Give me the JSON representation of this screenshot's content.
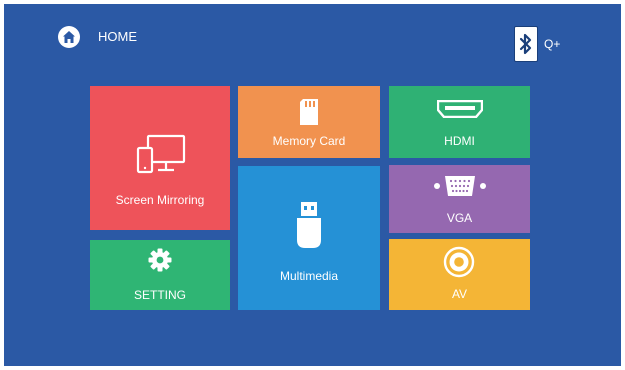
{
  "header": {
    "home_label": "HOME",
    "home_icon": "home-icon",
    "bluetooth_icon": "bluetooth-icon",
    "status_label": "Q+"
  },
  "tiles": [
    {
      "label": "Screen Mirroring",
      "icon": "screen-mirroring-icon",
      "color": "#ee535a"
    },
    {
      "label": "Memory Card",
      "icon": "memory-card-icon",
      "color": "#f1924f"
    },
    {
      "label": "HDMI",
      "icon": "hdmi-icon",
      "color": "#2fb174"
    },
    {
      "label": "Multimedia",
      "icon": "usb-drive-icon",
      "color": "#2591d6"
    },
    {
      "label": "VGA",
      "icon": "vga-icon",
      "color": "#9568b0"
    },
    {
      "label": "SETTING",
      "icon": "gear-icon",
      "color": "#2fb574"
    },
    {
      "label": "AV",
      "icon": "av-icon",
      "color": "#f4b536"
    }
  ],
  "colors": {
    "background": "#2b59a5"
  }
}
